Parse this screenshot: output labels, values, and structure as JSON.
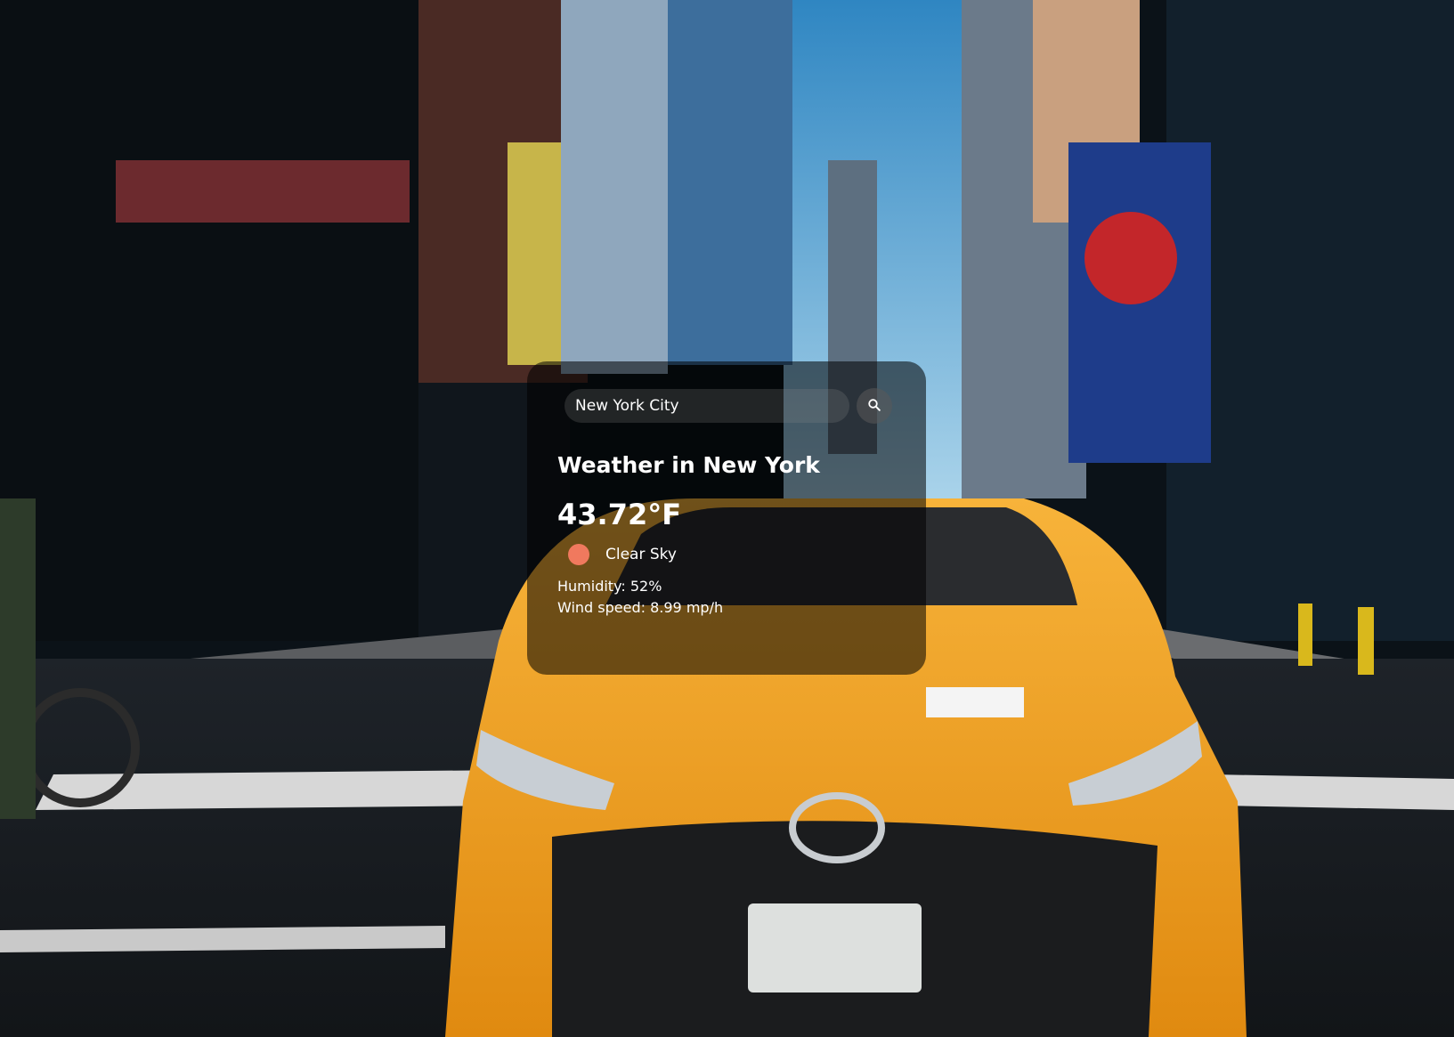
{
  "search": {
    "value": "New York City",
    "placeholder": "Search"
  },
  "weather": {
    "heading": "Weather in New York",
    "temperature": "43.72°F",
    "condition": "Clear Sky",
    "humidity": "Humidity: 52%",
    "wind": "Wind speed: 8.99 mp/h"
  },
  "icons": {
    "search": "search-icon",
    "condition": "weather-condition-icon"
  },
  "colors": {
    "condition_dot": "#f0795e",
    "card_background": "rgba(0,0,0,0.55)",
    "taxi_yellow": "#f5a623",
    "sky": "#3e8fc4"
  }
}
